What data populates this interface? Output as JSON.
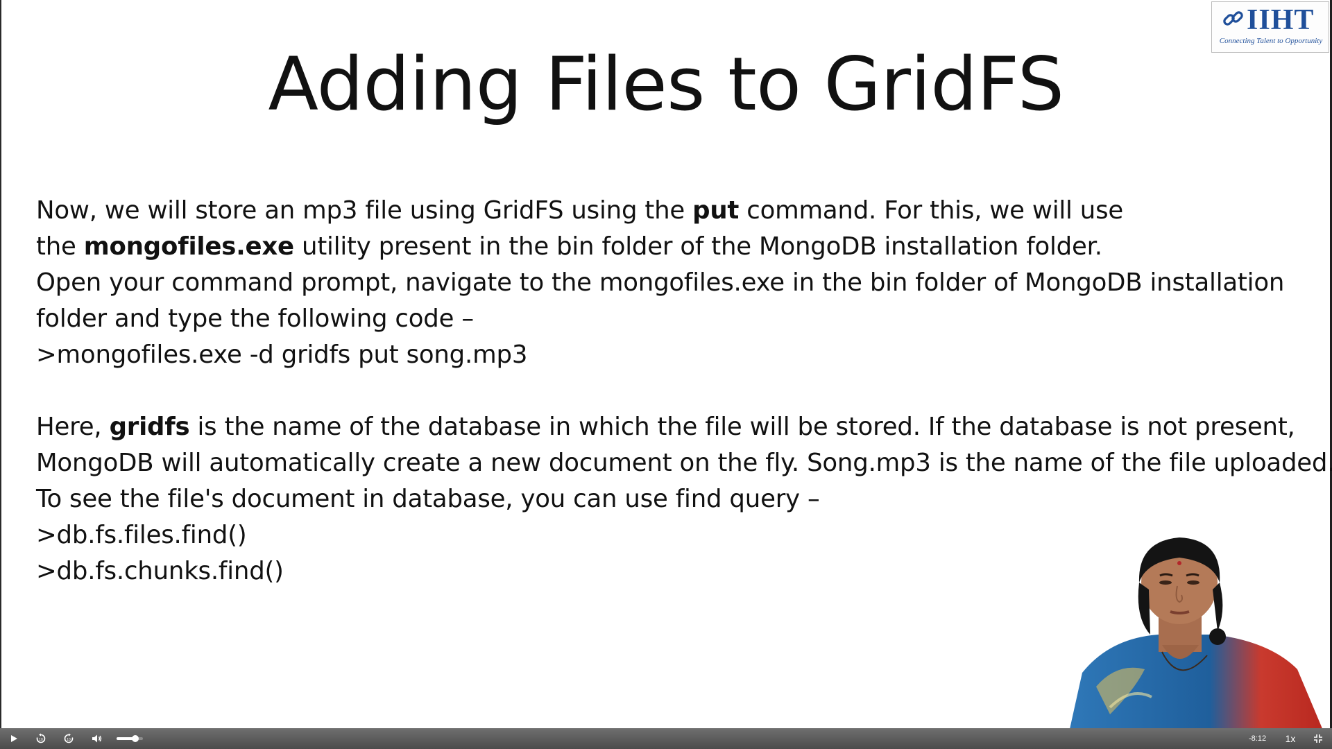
{
  "slide": {
    "title": "Adding Files to GridFS",
    "paragraph1": [
      [
        {
          "text": "Now, we will store an mp3 file using GridFS using the ",
          "bold": false
        },
        {
          "text": "put",
          "bold": true
        },
        {
          "text": " command. For this, we will use",
          "bold": false
        }
      ],
      [
        {
          "text": "the ",
          "bold": false
        },
        {
          "text": "mongofiles.exe",
          "bold": true
        },
        {
          "text": "  utility present in the bin folder of the MongoDB installation folder.",
          "bold": false
        }
      ],
      [
        {
          "text": "Open your command prompt, navigate to the mongofiles.exe in the bin folder of MongoDB installation",
          "bold": false
        }
      ],
      [
        {
          "text": "folder and type the following code –",
          "bold": false
        }
      ],
      [
        {
          "text": ">mongofiles.exe -d gridfs put song.mp3",
          "bold": false
        }
      ]
    ],
    "paragraph2": [
      [
        {
          "text": "Here, ",
          "bold": false
        },
        {
          "text": "gridfs",
          "bold": true
        },
        {
          "text": " is the name of the database in which the file will be stored. If the database is not present,",
          "bold": false
        }
      ],
      [
        {
          "text": "MongoDB will automatically create a new document on the fly. Song.mp3 is the name of the file uploaded.",
          "bold": false
        }
      ],
      [
        {
          "text": "To see the file's document in database, you can use find query –",
          "bold": false
        }
      ],
      [
        {
          "text": ">db.fs.files.find()",
          "bold": false
        }
      ],
      [
        {
          "text": ">db.fs.chunks.find()",
          "bold": false
        }
      ]
    ]
  },
  "logo": {
    "wordmark": "IIHT",
    "tagline": "Connecting Talent to Opportunity",
    "icon": "chain-link-icon",
    "color": "#1f4f9a"
  },
  "player": {
    "play_icon": "play-icon",
    "rewind_icon": "rewind-10-icon",
    "forward_icon": "forward-10-icon",
    "volume_icon": "volume-icon",
    "volume_level": 0.7,
    "time_remaining": "-8:12",
    "speed": "1x",
    "fullscreen_icon": "exit-fullscreen-icon"
  },
  "colors": {
    "slide_background": "#ffffff",
    "text": "#111111",
    "control_bar": "#5a5a5a",
    "logo_blue": "#1f4f9a"
  }
}
